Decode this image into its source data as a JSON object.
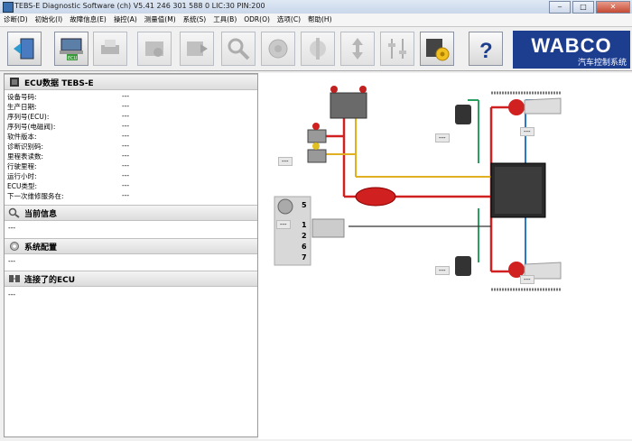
{
  "window": {
    "title": "TEBS-E Diagnostic Software (ch) V5.41  246 301 588 0  LIC:30 PIN:200"
  },
  "menu": [
    {
      "label": "诊断(D)"
    },
    {
      "label": "初始化(I)"
    },
    {
      "label": "故障信息(E)"
    },
    {
      "label": "操控(A)"
    },
    {
      "label": "测量值(M)"
    },
    {
      "label": "系统(S)"
    },
    {
      "label": "工具(B)"
    },
    {
      "label": "ODR(O)"
    },
    {
      "label": "选项(C)"
    },
    {
      "label": "帮助(H)"
    }
  ],
  "logo": {
    "brand": "WABCO",
    "tagline": "汽车控制系统"
  },
  "toolbar": {
    "ecu_label": "ECU",
    "help_label": "?"
  },
  "ecu_section": {
    "title": "ECU数据 TEBS-E",
    "fields": [
      {
        "label": "设备号码:",
        "value": "---"
      },
      {
        "label": "生产日期:",
        "value": "---"
      },
      {
        "label": "序列号(ECU):",
        "value": "---"
      },
      {
        "label": "序列号(电磁阀):",
        "value": "---"
      },
      {
        "label": "软件版本:",
        "value": "---"
      },
      {
        "label": "诊断识别码:",
        "value": "---"
      },
      {
        "label": "里程表读数:",
        "value": "---"
      },
      {
        "label": "行驶里程:",
        "value": "---"
      },
      {
        "label": "运行小时:",
        "value": "---"
      },
      {
        "label": "ECU类型:",
        "value": "---"
      },
      {
        "label": "下一次维修服务在:",
        "value": "---"
      }
    ]
  },
  "current_info": {
    "title": "当前信息",
    "value": "---"
  },
  "system_config": {
    "title": "系统配置",
    "value": "---"
  },
  "connected_ecu": {
    "title": "连接了的ECU",
    "value": "---"
  },
  "diagram": {
    "labels": [
      "---",
      "---",
      "---",
      "---",
      "---",
      "---"
    ],
    "connectors": [
      "5",
      "1",
      "2",
      "6",
      "7"
    ]
  }
}
